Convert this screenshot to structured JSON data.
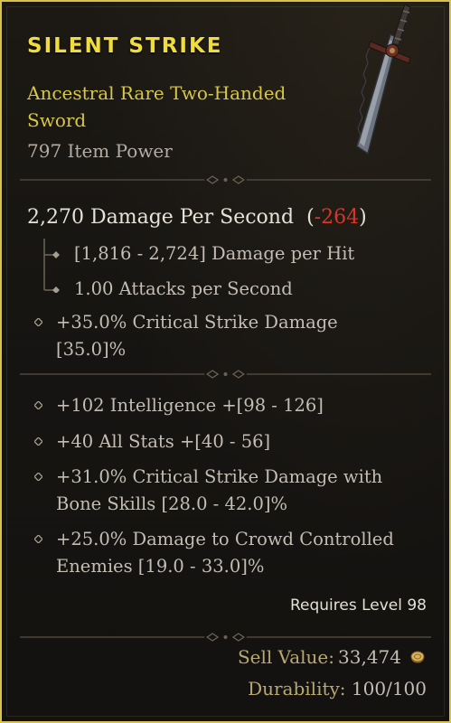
{
  "item": {
    "name": "SILENT STRIKE",
    "type_line": "Ancestral Rare Two-Handed Sword",
    "item_power": "797 Item Power",
    "icon": "two-handed-sword-icon"
  },
  "weapon": {
    "dps": "2,270 Damage Per Second",
    "dps_delta_open": "(",
    "dps_delta": "-264",
    "dps_delta_close": ")",
    "damage_per_hit": "[1,816 - 2,724] Damage per Hit",
    "attacks_per_second": "1.00 Attacks per Second",
    "implicit": "+35.0% Critical Strike Damage [35.0]%"
  },
  "affixes": [
    {
      "text": "+102 Intelligence +[98 - 126]"
    },
    {
      "text": "+40 All Stats +[40 - 56]"
    },
    {
      "text": "+31.0% Critical Strike Damage with Bone Skills [28.0 - 42.0]%"
    },
    {
      "text": "+25.0% Damage to Crowd Controlled Enemies [19.0 - 33.0]%"
    }
  ],
  "requirements": {
    "level": "Requires Level 98"
  },
  "footer": {
    "sell_label": "Sell Value:",
    "sell_value": "33,474",
    "durability_label": "Durability:",
    "durability_value": "100/100"
  },
  "colors": {
    "border": "#d8c24c",
    "title": "#f0dc3c",
    "type_line": "#d7c744",
    "negative": "#d8362b"
  }
}
